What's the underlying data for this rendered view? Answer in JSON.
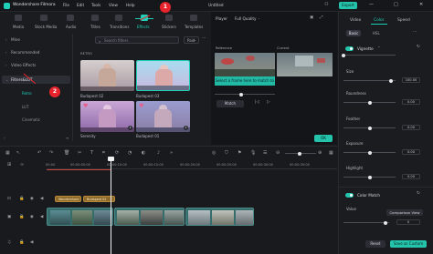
{
  "app": {
    "name": "Wondershare Filmora",
    "menu": [
      "File",
      "Edit",
      "Tools",
      "View",
      "Help"
    ],
    "document_title": "Untitled",
    "export_label": "Export",
    "window_controls": [
      "—",
      "□",
      "✕"
    ]
  },
  "library_tabs": [
    {
      "label": "Media",
      "icon": "media-icon"
    },
    {
      "label": "Stock Media",
      "icon": "stock-media-icon"
    },
    {
      "label": "Audio",
      "icon": "audio-icon"
    },
    {
      "label": "Titles",
      "icon": "titles-icon"
    },
    {
      "label": "Transitions",
      "icon": "transitions-icon"
    },
    {
      "label": "Effects",
      "icon": "effects-icon",
      "active": true
    },
    {
      "label": "Stickers",
      "icon": "stickers-icon"
    },
    {
      "label": "Templates",
      "icon": "templates-icon"
    }
  ],
  "sidebar": {
    "categories": [
      {
        "label": "Mine"
      },
      {
        "label": "Recommended"
      },
      {
        "label": "Video Effects"
      },
      {
        "label": "Filters&LUT",
        "active": true
      }
    ],
    "subcategories": [
      {
        "label": "Retro",
        "active": true
      },
      {
        "label": "LUT"
      },
      {
        "label": "Cinematic"
      }
    ]
  },
  "search": {
    "placeholder": "Search filters",
    "filter_label": "Paid"
  },
  "section_label": "RETRO",
  "effects": [
    {
      "name": "Budapest 02"
    },
    {
      "name": "Budapest 03"
    },
    {
      "name": "Serenity"
    },
    {
      "name": "Budapest 01"
    }
  ],
  "player": {
    "label": "Player",
    "quality": "Full Quality",
    "reference_label": "Reference",
    "current_label": "Current",
    "overlay_text": "Select a frame here to match to",
    "match_label": "Match",
    "ok_label": "OK"
  },
  "timeline": {
    "ruler": [
      "00:00",
      "00:00:05:00",
      "00:00:10:00",
      "00:00:15:00",
      "00:00:20:00",
      "00:00:25:00",
      "00:00:30:00",
      "00:00:35:00"
    ],
    "audio_clips": [
      "Wondershare",
      "Budapest 02"
    ]
  },
  "right_panel": {
    "tabs": [
      "Video",
      "Color",
      "Speed"
    ],
    "active_tab": "Color",
    "subtabs": [
      "Basic",
      "HSL"
    ],
    "vignette_label": "Vignette",
    "params": [
      {
        "label": "Size",
        "value": "100.00",
        "level": 0.92
      },
      {
        "label": "Roundness",
        "value": "0.00",
        "level": 0.5
      },
      {
        "label": "Feather",
        "value": "0.00",
        "level": 0.5
      },
      {
        "label": "Exposure",
        "value": "0.00",
        "level": 0.5
      },
      {
        "label": "Highlight",
        "value": "0.00",
        "level": 0.5
      }
    ],
    "color_match_label": "Color Match",
    "value_label": "Value",
    "value_amount": "0",
    "value_level": 0.92,
    "comparison_view_label": "Comparison View",
    "reset_label": "Reset",
    "save_label": "Save as Custom"
  },
  "annotations": [
    "1",
    "2"
  ],
  "colors": {
    "accent": "#1fd0b8",
    "annotation": "#e8232c",
    "audio_clip": "#8e6b2b",
    "video_clip": "#356c6c"
  }
}
